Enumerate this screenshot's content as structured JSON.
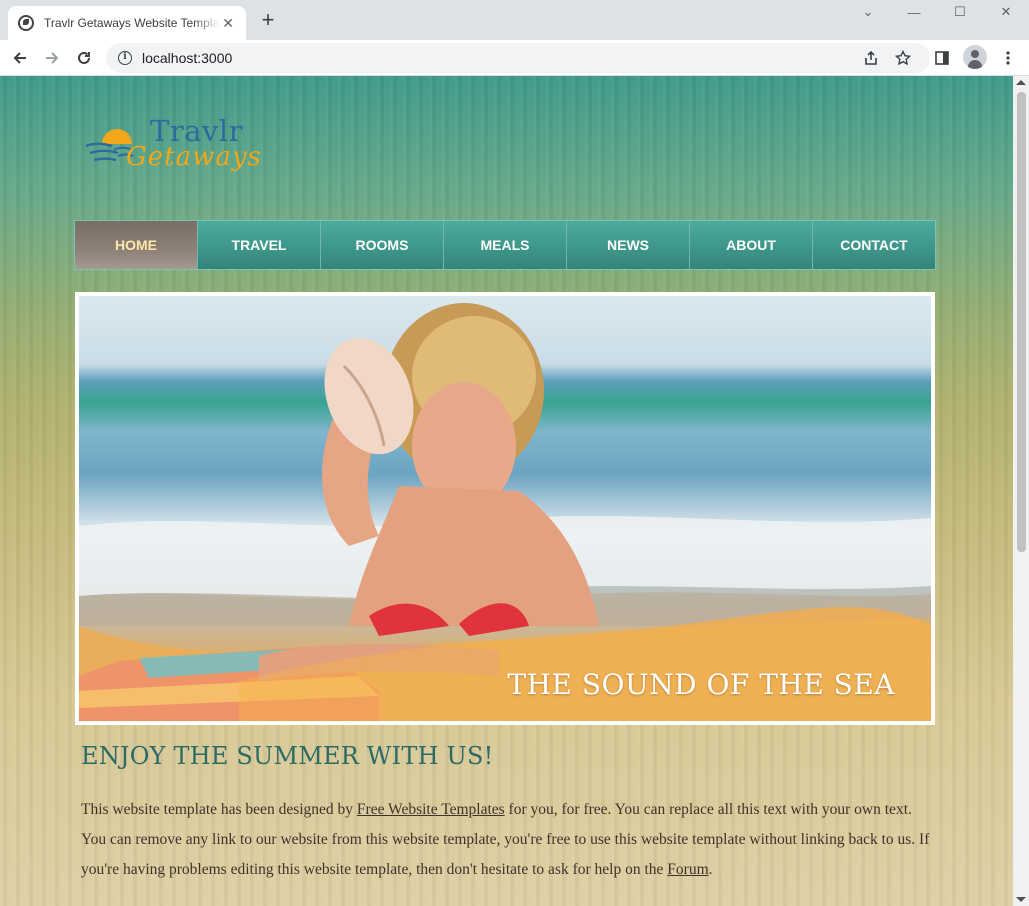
{
  "browser": {
    "tab_title": "Travlr Getaways Website Template",
    "tab_close": "✕",
    "new_tab": "+",
    "url": "localhost:3000",
    "window_controls": [
      "⌄",
      "—",
      "☐",
      "✕"
    ]
  },
  "site": {
    "logo": {
      "line1": "Travlr",
      "line2": "Getaways"
    },
    "nav": [
      {
        "label": "HOME",
        "active": true
      },
      {
        "label": "TRAVEL"
      },
      {
        "label": "ROOMS"
      },
      {
        "label": "MEALS"
      },
      {
        "label": "NEWS"
      },
      {
        "label": "ABOUT"
      },
      {
        "label": "CONTACT"
      }
    ],
    "hero": {
      "caption": "THE SOUND OF THE SEA"
    },
    "content": {
      "headline": "ENJOY THE SUMMER WITH US!",
      "p1": "This website template has been designed by ",
      "link1": "Free Website Templates",
      "p2": " for you, for free. You can replace all this text with your own text. You can remove any link to our website from this website template, you're free to use this website template without linking back to us. If you're having problems editing this website template, then don't hesitate to ask for help on the ",
      "link2": "Forum",
      "p3": "."
    }
  },
  "colors": {
    "nav_teal": "#3e978a",
    "nav_active": "#8d8177",
    "headline": "#2b6b66",
    "logo_blue": "#2c6aa0",
    "logo_orange": "#f2a71b"
  }
}
